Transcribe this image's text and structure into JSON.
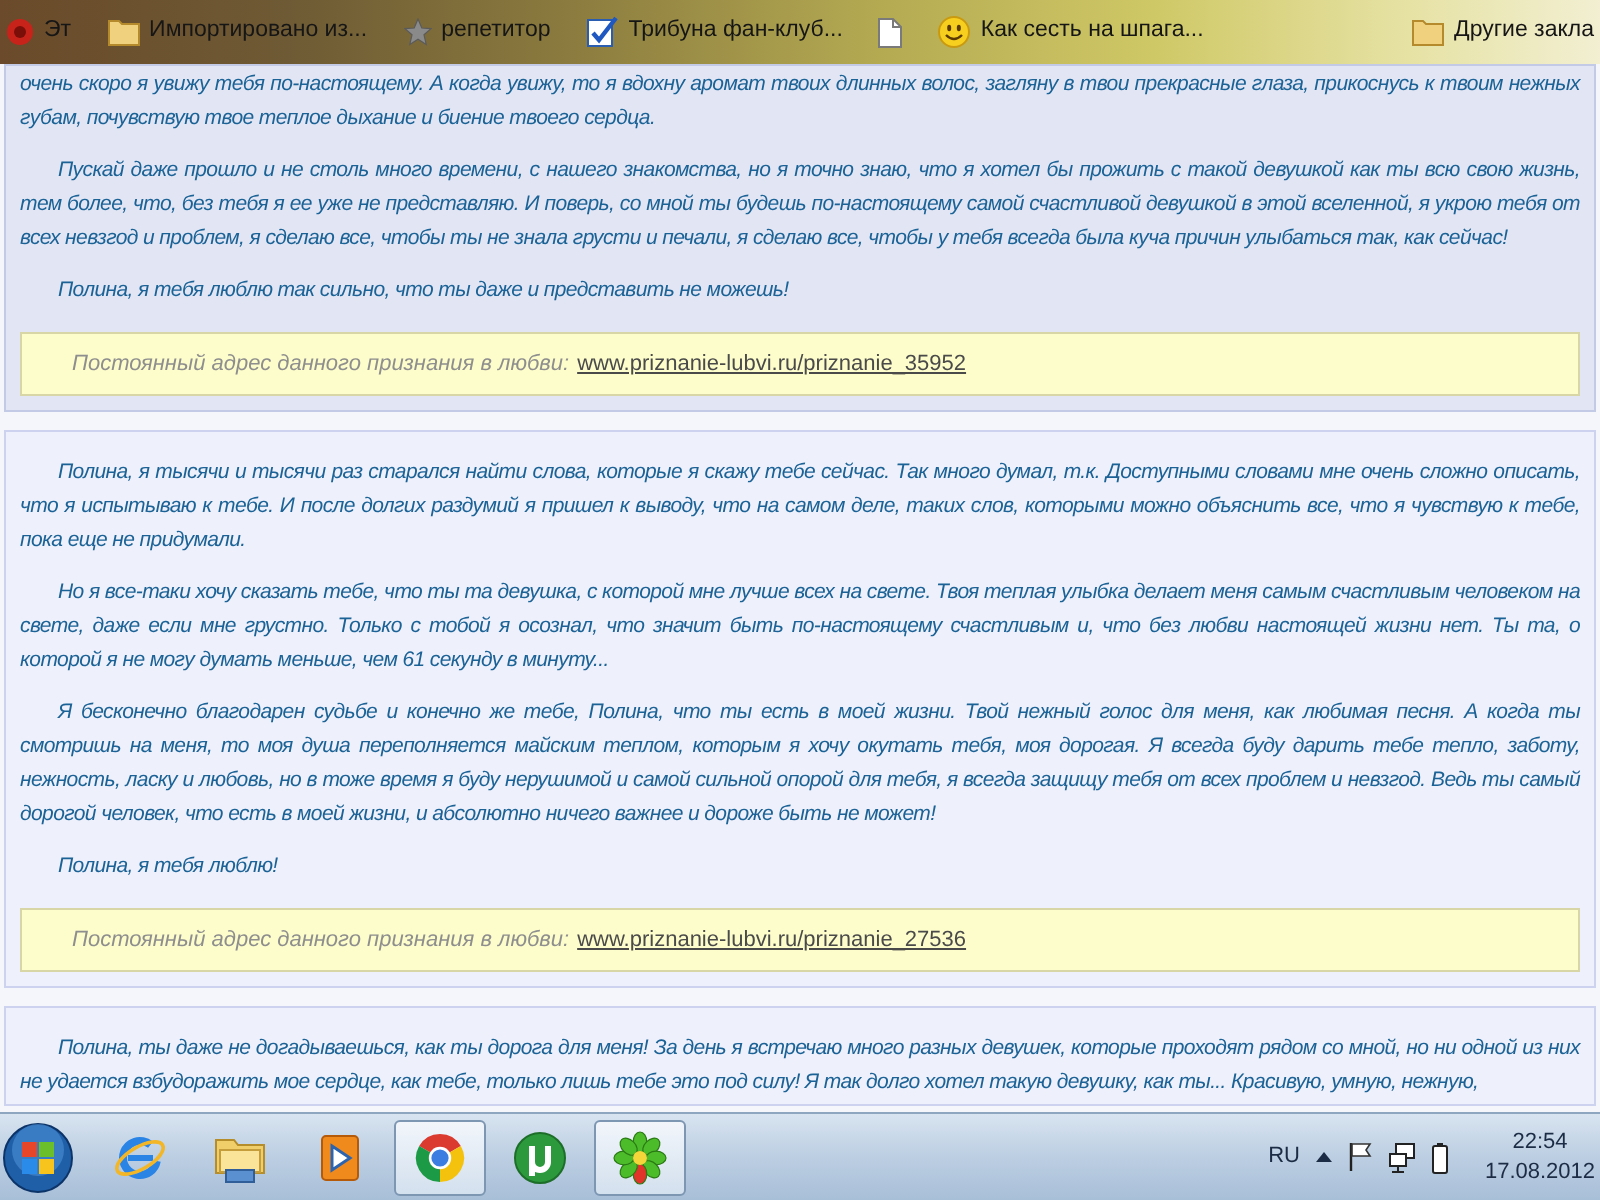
{
  "bookmarks_bar": {
    "items": [
      {
        "kind": "app",
        "label": "Эт"
      },
      {
        "kind": "folder",
        "label": "Импортировано из..."
      },
      {
        "kind": "star",
        "label": "репетитор"
      },
      {
        "kind": "check",
        "label": "Трибуна фан-клуб..."
      },
      {
        "kind": "page"
      },
      {
        "kind": "smiley",
        "label": "Как сесть на шпага..."
      }
    ],
    "other": {
      "kind": "folder",
      "label": "Другие закла"
    }
  },
  "confessions": [
    {
      "highlighted": true,
      "continued_text": "очень скоро я увижу тебя по-настоящему. А когда увижу, то я вдохну аромат твоих длинных волос, загляну в твои прекрасные глаза, прикоснусь к твоим нежных губам, почувствую твое теплое дыхание и биение твоего сердца.",
      "paragraphs": [
        "Пускай даже прошло и не столь много времени, с нашего знакомства, но я точно знаю, что я хотел бы прожить с такой девушкой как ты всю свою жизнь, тем более, что, без тебя я ее уже не представляю. И поверь, со мной ты будешь по-настоящему самой счастливой девушкой в этой вселенной, я укрою тебя от всех невзгод и проблем, я сделаю все, чтобы ты не знала грусти и печали, я сделаю все, чтобы у тебя всегда была куча причин улыбаться так, как сейчас!",
        "Полина, я тебя люблю так сильно, что ты даже и представить не можешь!"
      ],
      "permalink": {
        "label": "Постоянный адрес данного признания в любви:",
        "url": "www.priznanie-lubvi.ru/priznanie_35952"
      }
    },
    {
      "highlighted": false,
      "paragraphs": [
        "Полина, я тысячи и тысячи раз старался найти слова, которые я скажу тебе сейчас. Так много думал, т.к. Доступными словами мне очень сложно описать, что я испытываю к тебе. И после долгих раздумий я пришел к выводу, что на самом деле, таких слов, которыми можно объяснить все, что я чувствую к тебе, пока еще не придумали.",
        "Но я все-таки хочу сказать тебе, что ты та девушка, с которой мне лучше всех на свете. Твоя теплая улыбка делает меня самым счастливым человеком на свете, даже если мне грустно. Только с тобой я осознал, что значит быть по-настоящему счастливым и, что без любви настоящей жизни нет. Ты та, о которой я не могу думать меньше, чем 61 секунду в минуту...",
        "Я бесконечно благодарен судьбе и конечно же тебе, Полина, что ты есть в моей жизни. Твой нежный голос для меня, как любимая песня. А когда ты смотришь на меня, то моя душа переполняется майским теплом, которым я хочу окутать тебя, моя дорогая. Я всегда буду дарить тебе тепло, заботу, нежность, ласку и любовь, но в тоже время я буду нерушимой и самой сильной опорой для тебя, я всегда защищу тебя от всех проблем и невзгод. Ведь ты самый дорогой человек, что есть в моей жизни, и абсолютно ничего важнее и дороже быть не может!",
        "Полина, я тебя люблю!"
      ],
      "permalink": {
        "label": "Постоянный адрес данного признания в любви:",
        "url": "www.priznanie-lubvi.ru/priznanie_27536"
      }
    },
    {
      "highlighted": false,
      "paragraphs": [
        "Полина, ты даже не догадываешься, как ты дорога для меня! За день я встречаю много разных девушек, которые проходят рядом со мной, но ни одной из них не удается взбудоражить мое сердце, как тебе, только лишь тебе это под силу! Я так долго хотел такую девушку, как ты... Красивую, умную, нежную,"
      ]
    }
  ],
  "taskbar": {
    "items": [
      {
        "kind": "ie",
        "active": false
      },
      {
        "kind": "explorer",
        "active": false
      },
      {
        "kind": "media",
        "active": false
      },
      {
        "kind": "chrome",
        "active": true
      },
      {
        "kind": "torrent",
        "active": false
      },
      {
        "kind": "icq",
        "active": true
      }
    ],
    "language": "RU",
    "time": "22:54",
    "date": "17.08.2012"
  }
}
